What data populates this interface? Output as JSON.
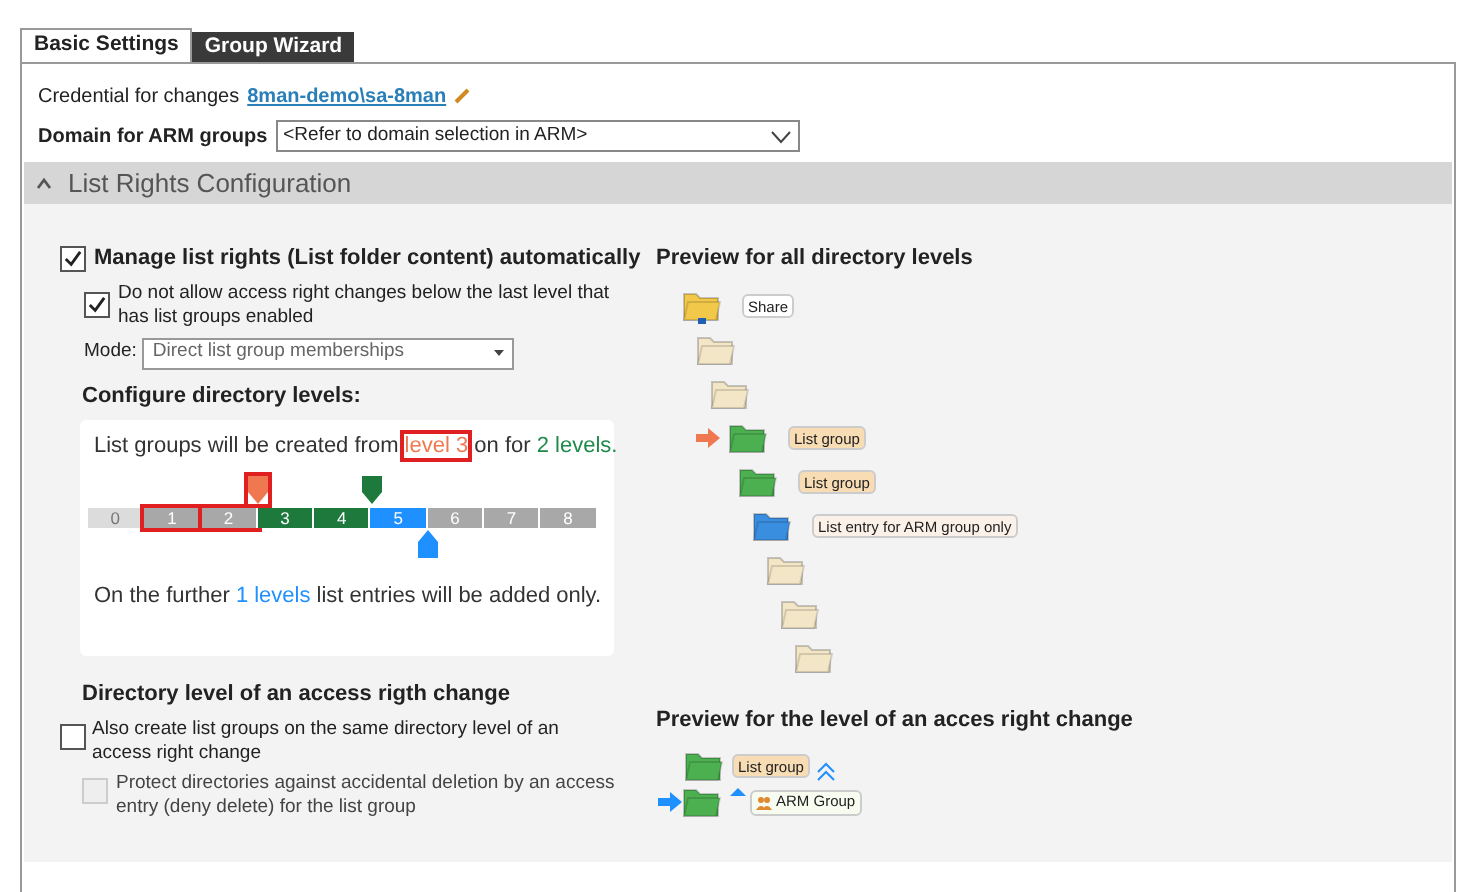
{
  "tabs": [
    {
      "label": "Basic Settings",
      "selected": true
    },
    {
      "label": "Group Wizard",
      "selected": false
    }
  ],
  "credential": {
    "label": "Credential for changes",
    "link": "8man-demo\\sa-8man"
  },
  "domain": {
    "label": "Domain for ARM groups",
    "value": "<Refer to domain selection in ARM>"
  },
  "section": {
    "title": "List Rights Configuration",
    "expanded": true
  },
  "manage": {
    "label": "Manage list rights (List folder content) automatically",
    "checked": true
  },
  "no_below": {
    "label": "Do not allow access right changes below the last level that has list groups enabled",
    "checked": true
  },
  "mode": {
    "label": "Mode:",
    "value": "Direct list group memberships"
  },
  "configure": {
    "title": "Configure directory levels:",
    "sentence": [
      {
        "text": "List groups will be created from ",
        "color": "#333333",
        "highlighted": false
      },
      {
        "text": "level 3",
        "color": "#f07850",
        "highlighted": true
      },
      {
        "text": " on for ",
        "color": "#333333",
        "highlighted": false
      },
      {
        "text": "2 levels.",
        "color": "#1e8a4a",
        "highlighted": false
      }
    ],
    "segments": [
      {
        "label": "0",
        "kind": "empty",
        "highlighted": false
      },
      {
        "label": "1",
        "kind": "inactive",
        "highlighted": true
      },
      {
        "label": "2",
        "kind": "inactive",
        "highlighted": true
      },
      {
        "label": "3",
        "kind": "group",
        "highlighted": false
      },
      {
        "label": "4",
        "kind": "group",
        "highlighted": false
      },
      {
        "label": "5",
        "kind": "entry",
        "highlighted": false
      },
      {
        "label": "6",
        "kind": "inactive",
        "highlighted": false
      },
      {
        "label": "7",
        "kind": "inactive",
        "highlighted": false
      },
      {
        "label": "8",
        "kind": "inactive",
        "highlighted": false
      }
    ],
    "start_marker_highlighted": true,
    "footer": [
      {
        "text": "On the further ",
        "color": "#333333",
        "highlighted": false
      },
      {
        "text": "1 levels",
        "color": "#1e90ff",
        "highlighted": false
      },
      {
        "text": " list entries will be added only.",
        "color": "#333333",
        "highlighted": false
      }
    ]
  },
  "preview_all": {
    "title": "Preview for all directory levels",
    "items": [
      {
        "kind": "share",
        "label": "Share",
        "arrow": false
      },
      {
        "kind": "plain",
        "arrow": false
      },
      {
        "kind": "plain",
        "arrow": false
      },
      {
        "kind": "group",
        "label": "List group",
        "arrow": true
      },
      {
        "kind": "group",
        "label": "List group",
        "arrow": false
      },
      {
        "kind": "entry",
        "label": "List entry for ARM group only",
        "arrow": false
      },
      {
        "kind": "plain",
        "arrow": false
      },
      {
        "kind": "plain",
        "arrow": false
      },
      {
        "kind": "plain",
        "arrow": false
      }
    ]
  },
  "access_change": {
    "title": "Directory level of an access rigth change",
    "also": {
      "label": "Also create list groups on the same directory level of an access right change",
      "checked": false
    },
    "protect": {
      "label": "Protect directories against accidental deletion by an access entry (deny delete) for the list group",
      "checked": false,
      "disabled": true
    }
  },
  "preview_change": {
    "title": "Preview for the level of an acces right change",
    "group_label": "List group",
    "arm_label": "ARM Group"
  }
}
